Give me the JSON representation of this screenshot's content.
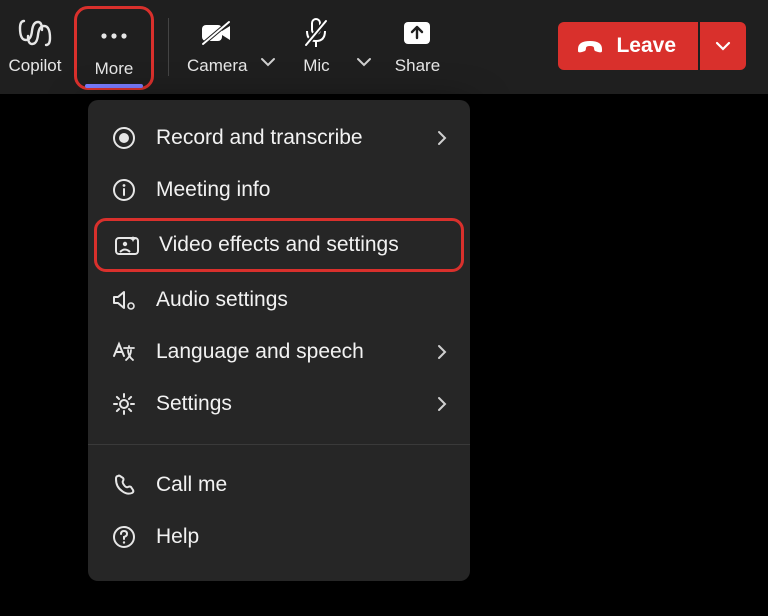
{
  "toolbar": {
    "copilot_label": "Copilot",
    "more_label": "More",
    "camera_label": "Camera",
    "mic_label": "Mic",
    "share_label": "Share",
    "leave_label": "Leave"
  },
  "menu": {
    "record_label": "Record and transcribe",
    "meeting_info_label": "Meeting info",
    "video_effects_label": "Video effects and settings",
    "audio_settings_label": "Audio settings",
    "language_label": "Language and speech",
    "settings_label": "Settings",
    "call_me_label": "Call me",
    "help_label": "Help"
  }
}
